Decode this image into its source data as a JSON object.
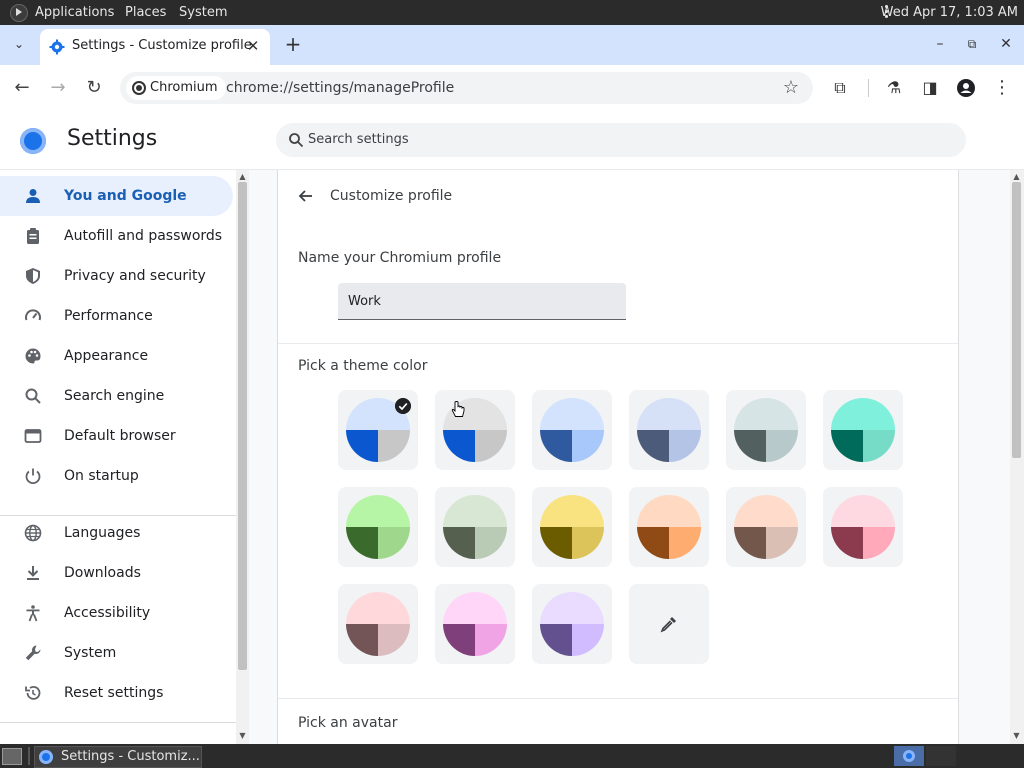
{
  "system_bar": {
    "menus": [
      "Applications",
      "Places",
      "System"
    ],
    "clock": "Wed Apr 17,  1:03 AM"
  },
  "browser": {
    "tab_title": "Settings - Customize profile",
    "omnibox": {
      "chip_label": "Chromium",
      "url": "chrome://settings/manageProfile"
    }
  },
  "settings": {
    "title": "Settings",
    "search_placeholder": "Search settings",
    "nav": [
      {
        "label": "You and Google",
        "icon": "person-icon",
        "active": true
      },
      {
        "label": "Autofill and passwords",
        "icon": "clipboard-icon"
      },
      {
        "label": "Privacy and security",
        "icon": "shield-icon"
      },
      {
        "label": "Performance",
        "icon": "speedometer-icon"
      },
      {
        "label": "Appearance",
        "icon": "palette-icon"
      },
      {
        "label": "Search engine",
        "icon": "search-icon"
      },
      {
        "label": "Default browser",
        "icon": "browser-window-icon"
      },
      {
        "label": "On startup",
        "icon": "power-icon"
      },
      {
        "label": "Languages",
        "icon": "globe-icon"
      },
      {
        "label": "Downloads",
        "icon": "download-icon"
      },
      {
        "label": "Accessibility",
        "icon": "accessibility-icon"
      },
      {
        "label": "System",
        "icon": "wrench-icon"
      },
      {
        "label": "Reset settings",
        "icon": "reset-icon"
      }
    ],
    "customize_profile": {
      "subtitle": "Customize profile",
      "name_label": "Name your Chromium profile",
      "name_value": "Work",
      "theme_label": "Pick a theme color",
      "avatar_label": "Pick an avatar",
      "theme_colors": [
        {
          "top": "#d3e3fd",
          "left": "#0b57d0",
          "right": "#c7c7c7",
          "selected": true
        },
        {
          "top": "#e3e3e3",
          "left": "#0b57d0",
          "right": "#c7c7c7"
        },
        {
          "top": "#d3e3fd",
          "left": "#2f5aa0",
          "right": "#a8c7fa"
        },
        {
          "top": "#d6e1f7",
          "left": "#4d5b7a",
          "right": "#b4c4e6"
        },
        {
          "top": "#d6e4e6",
          "left": "#52605f",
          "right": "#b7c9ca"
        },
        {
          "top": "#7ef0db",
          "left": "#006b5b",
          "right": "#76dbc7"
        },
        {
          "top": "#b6f5a5",
          "left": "#3a6b2c",
          "right": "#9fd88c"
        },
        {
          "top": "#d8e6d4",
          "left": "#55604f",
          "right": "#b9cbb4"
        },
        {
          "top": "#f9e380",
          "left": "#6b5c00",
          "right": "#dcc45a"
        },
        {
          "top": "#ffd9c2",
          "left": "#8f4a15",
          "right": "#ffac70"
        },
        {
          "top": "#ffdbcb",
          "left": "#73574b",
          "right": "#d9bfb4"
        },
        {
          "top": "#ffd9e1",
          "left": "#8c3b4e",
          "right": "#ffa9ba"
        },
        {
          "top": "#ffd8dc",
          "left": "#735558",
          "right": "#dcbcbf"
        },
        {
          "top": "#ffd6f8",
          "left": "#7f3f7a",
          "right": "#f0a4e6"
        },
        {
          "top": "#eadcff",
          "left": "#62508f",
          "right": "#d0bcff"
        }
      ],
      "custom_color": "eyedropper-icon"
    }
  },
  "taskbar": {
    "window_title": "Settings - Customiz..."
  }
}
